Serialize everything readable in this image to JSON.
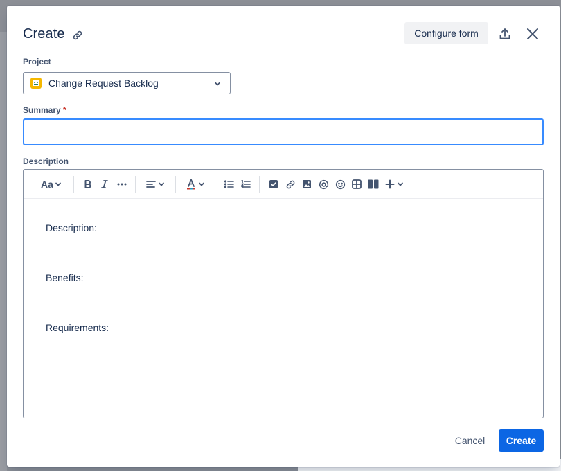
{
  "dialog": {
    "title": "Create",
    "configure_label": "Configure form"
  },
  "project": {
    "label": "Project",
    "selected": "Change Request Backlog"
  },
  "summary": {
    "label": "Summary",
    "required_mark": "*",
    "value": ""
  },
  "description": {
    "label": "Description",
    "toolbar": {
      "text_style": "Aa",
      "items": [
        "text-style",
        "bold",
        "italic",
        "more-formatting",
        "align",
        "text-color",
        "bullet-list",
        "numbered-list",
        "action-item",
        "link",
        "image",
        "mention",
        "emoji",
        "table",
        "layouts",
        "insert"
      ]
    },
    "lines": [
      "Description:",
      "Benefits:",
      "Requirements:"
    ]
  },
  "footer": {
    "cancel_label": "Cancel",
    "create_label": "Create"
  },
  "colors": {
    "primary": "#0c66e4",
    "focus_border": "#388bff",
    "required": "#c9372c",
    "project_avatar": "#f5b800"
  }
}
